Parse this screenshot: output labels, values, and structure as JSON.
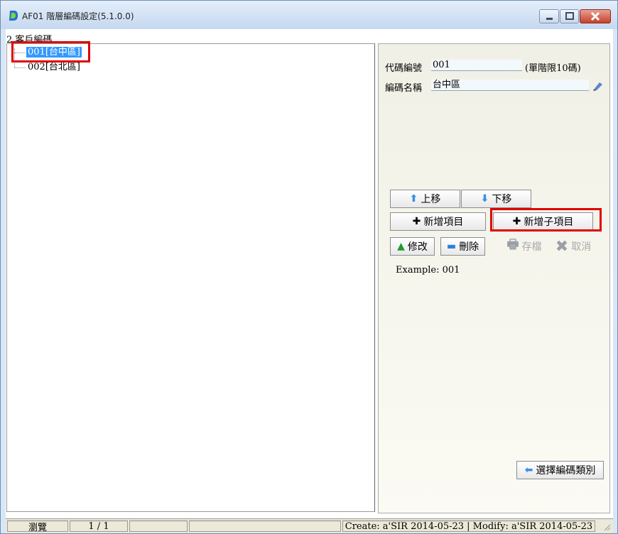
{
  "window": {
    "title": "AF01 階層編碼設定(5.1.0.0)",
    "controls": [
      "minimize",
      "maximize",
      "close"
    ]
  },
  "tree": {
    "root_label": "2.客戶編碼",
    "nodes": [
      {
        "label": "001[台中區]",
        "selected": true
      },
      {
        "label": "002[台北區]",
        "selected": false
      }
    ]
  },
  "form": {
    "code_label": "代碼編號",
    "code_value": "001",
    "code_hint": "(單階限10碼)",
    "name_label": "編碼名稱",
    "name_value": "台中區"
  },
  "buttons": {
    "move_up": "上移",
    "move_down": "下移",
    "add_item": "新增項目",
    "add_child": "新增子項目",
    "edit": "修改",
    "delete": "刪除",
    "save": "存檔",
    "cancel": "取消",
    "select_category": "選擇編碼類別"
  },
  "example_text": "Example: 001",
  "status": {
    "mode": "瀏覽",
    "page": "1 / 1",
    "audit": "Create: a'SIR 2014-05-23 | Modify: a'SIR 2014-05-23"
  },
  "colors": {
    "selection": "#3399ff",
    "highlight_border": "#e00000",
    "titlebar": "#c5d8ef"
  }
}
